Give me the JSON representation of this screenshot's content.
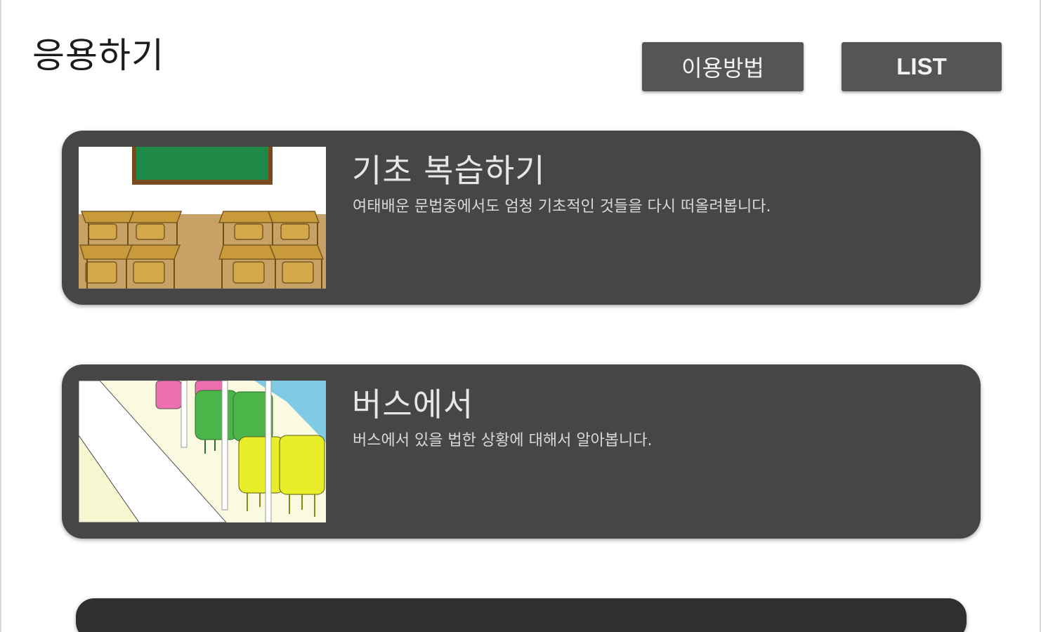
{
  "header": {
    "title": "응용하기",
    "how_to_label": "이용방법",
    "list_label": "LIST"
  },
  "cards": [
    {
      "title": "기초 복습하기",
      "description": "여태배운 문법중에서도 엄청 기초적인 것들을 다시 떠올려봅니다.",
      "thumbnail": "classroom-illustration"
    },
    {
      "title": "버스에서",
      "description": "버스에서 있을 법한 상황에 대해서 알아봅니다.",
      "thumbnail": "bus-interior-illustration"
    }
  ],
  "colors": {
    "card_background": "#464646",
    "button_background": "#555555",
    "page_background": "#ffffff"
  }
}
